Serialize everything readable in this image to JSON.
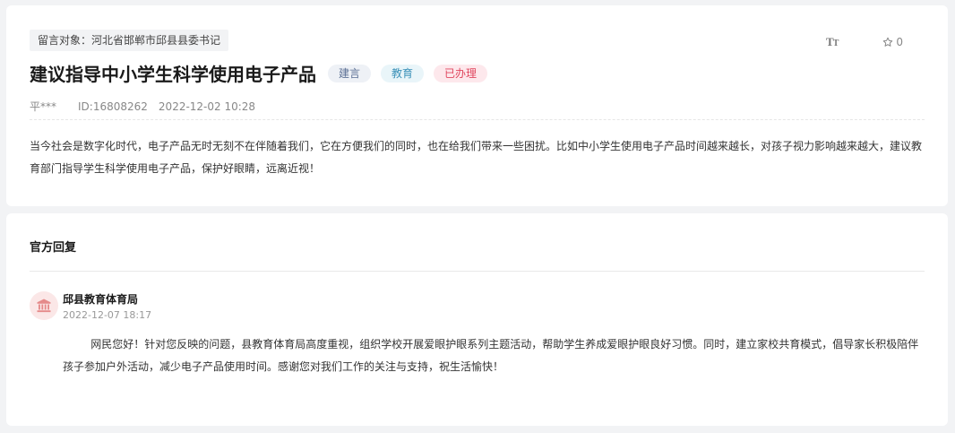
{
  "message": {
    "target_label": "留言对象：河北省邯郸市邱县县委书记",
    "title": "建议指导中小学生科学使用电子产品",
    "tags": {
      "type": "建言",
      "category": "教育",
      "status": "已办理"
    },
    "author": "平***",
    "id_text": "ID:16808262",
    "date": "2022-12-02 10:28",
    "content": "当今社会是数字化时代，电子产品无时无刻不在伴随着我们，它在方便我们的同时，也在给我们带来一些困扰。比如中小学生使用电子产品时间越来越长，对孩子视力影响越来越大，建议教育部门指导学生科学使用电子产品，保护好眼睛，远离近视！",
    "toolbar": {
      "font_size_big": "T",
      "font_size_small": "T",
      "favorite_count": "0"
    }
  },
  "reply": {
    "section_title": "官方回复",
    "org_name": "邱县教育体育局",
    "date": "2022-12-07 18:17",
    "content": "网民您好！针对您反映的问题，县教育体育局高度重视，组织学校开展爱眼护眼系列主题活动，帮助学生养成爱眼护眼良好习惯。同时，建立家校共育模式，倡导家长积极陪伴孩子参加户外活动，减少电子产品使用时间。感谢您对我们工作的关注与支持，祝生活愉快！"
  },
  "colors": {
    "status_tag": "#e0475f",
    "category_tag": "#3b91b8",
    "type_tag": "#5a6f94",
    "avatar_icon": "#e58a8a"
  },
  "icons": {
    "font_size": "font-size-icon",
    "favorite": "star-outline-icon",
    "avatar": "government-building-icon"
  }
}
